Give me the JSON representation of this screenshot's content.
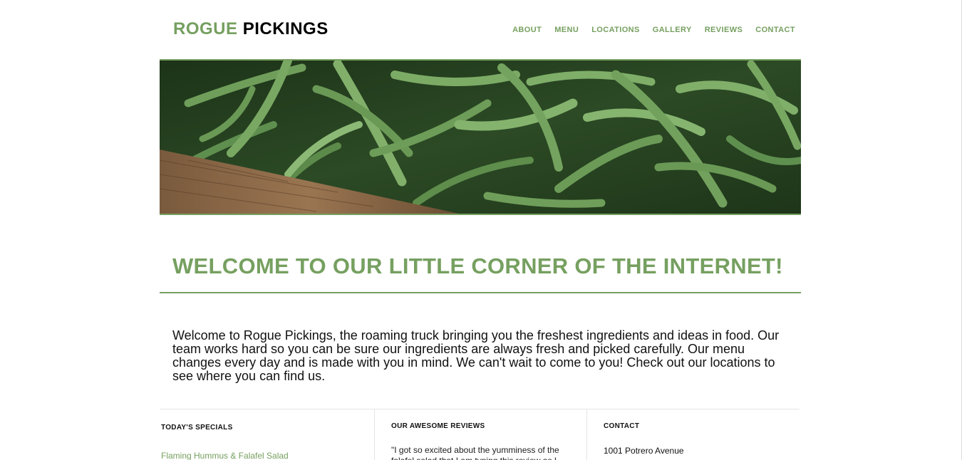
{
  "header": {
    "logo_part1": "ROGUE",
    "logo_part2": "PICKINGS",
    "nav": [
      "ABOUT",
      "MENU",
      "LOCATIONS",
      "GALLERY",
      "REVIEWS",
      "CONTACT"
    ]
  },
  "hero": {
    "image_subject": "green beans in a wooden crate"
  },
  "welcome": {
    "title": "WELCOME TO OUR LITTLE CORNER OF THE INTERNET!",
    "body": "Welcome to Rogue Pickings, the roaming truck bringing you the freshest ingredients and ideas in food. Our team works hard so you can be sure our ingredients are always fresh and picked carefully. Our menu changes every day and is made with you in mind. We can't wait to come to you! Check out our locations to see where you can find us."
  },
  "columns": {
    "specials": {
      "heading": "TODAY'S SPECIALS",
      "item": "Flaming Hummus & Falafel Salad"
    },
    "reviews": {
      "heading": "OUR AWESOME REVIEWS",
      "quote": "\"I got so excited about the yumminess of the falafel salad that I am typing this review as I"
    },
    "contact": {
      "heading": "CONTACT",
      "address": "1001 Potrero Avenue"
    }
  },
  "colors": {
    "accent": "#76a060",
    "text": "#111111",
    "divider": "#e4e4e4"
  }
}
